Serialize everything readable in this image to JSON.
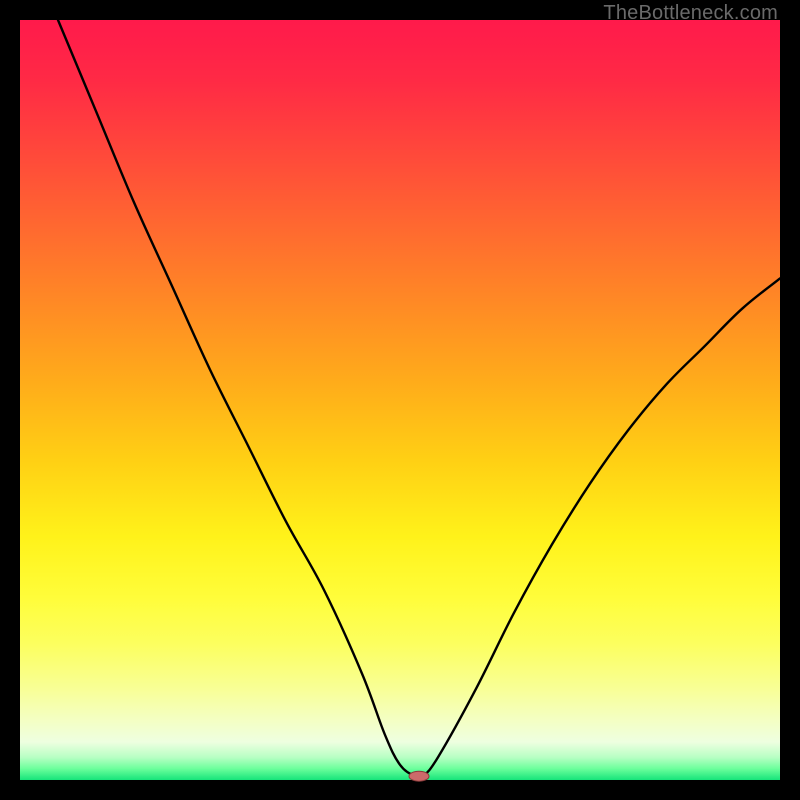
{
  "watermark": "TheBottleneck.com",
  "chart_data": {
    "type": "line",
    "title": "",
    "xlabel": "",
    "ylabel": "",
    "xlim": [
      0,
      100
    ],
    "ylim": [
      0,
      100
    ],
    "grid": false,
    "legend": false,
    "background_gradient": {
      "top": "#ff1a4b",
      "mid_top": "#ffad1a",
      "mid": "#fff21a",
      "mid_bottom": "#f4ffc2",
      "bottom": "#16e47a"
    },
    "series": [
      {
        "name": "bottleneck-curve",
        "color": "#000000",
        "x": [
          5,
          10,
          15,
          20,
          25,
          30,
          35,
          40,
          45,
          48,
          50,
          52,
          53,
          55,
          60,
          65,
          70,
          75,
          80,
          85,
          90,
          95,
          100
        ],
        "y": [
          100,
          88,
          76,
          65,
          54,
          44,
          34,
          25,
          14,
          6,
          2,
          0.5,
          0.5,
          3,
          12,
          22,
          31,
          39,
          46,
          52,
          57,
          62,
          66
        ]
      }
    ],
    "minimum_marker": {
      "x": 52.5,
      "y": 0.5,
      "color": "#cc6a6a"
    }
  }
}
